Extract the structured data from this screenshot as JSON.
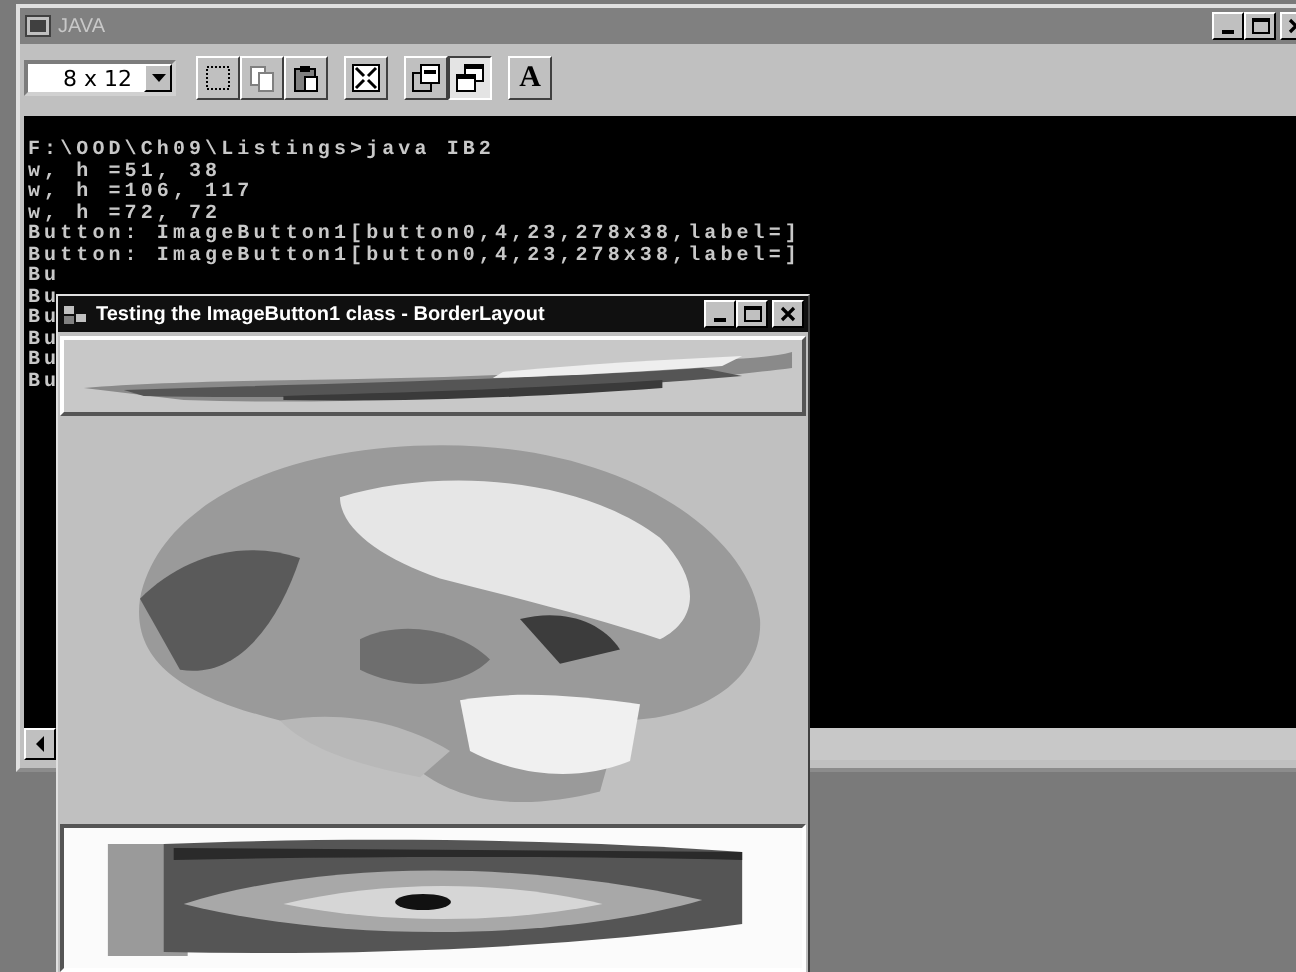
{
  "console_window": {
    "title": "JAVA",
    "active": false,
    "font_size": "8 x 12",
    "toolbar": [
      {
        "kind": "mark",
        "pressed": false,
        "disabled": false
      },
      {
        "kind": "copy",
        "pressed": false,
        "disabled": true
      },
      {
        "kind": "paste",
        "pressed": false,
        "disabled": false
      },
      {
        "kind": "fullscreen",
        "pressed": false,
        "disabled": false
      },
      {
        "kind": "properties",
        "pressed": false,
        "disabled": false
      },
      {
        "kind": "background",
        "pressed": true,
        "disabled": false
      },
      {
        "kind": "font",
        "label": "A",
        "pressed": false,
        "disabled": false
      }
    ],
    "lines": [
      "F:\\OOD\\Ch09\\Listings>java IB2",
      "w, h =51, 38",
      "w, h =106, 117",
      "w, h =72, 72",
      "Button: ImageButton1[button0,4,23,278x38,label=]",
      "Button: ImageButton1[button0,4,23,278x38,label=]",
      "Bu",
      "Bu",
      "Bu",
      "Bu",
      "Bu",
      "Bu"
    ]
  },
  "frame_window": {
    "title": "Testing the ImageButton1 class - BorderLayout",
    "active": true
  }
}
